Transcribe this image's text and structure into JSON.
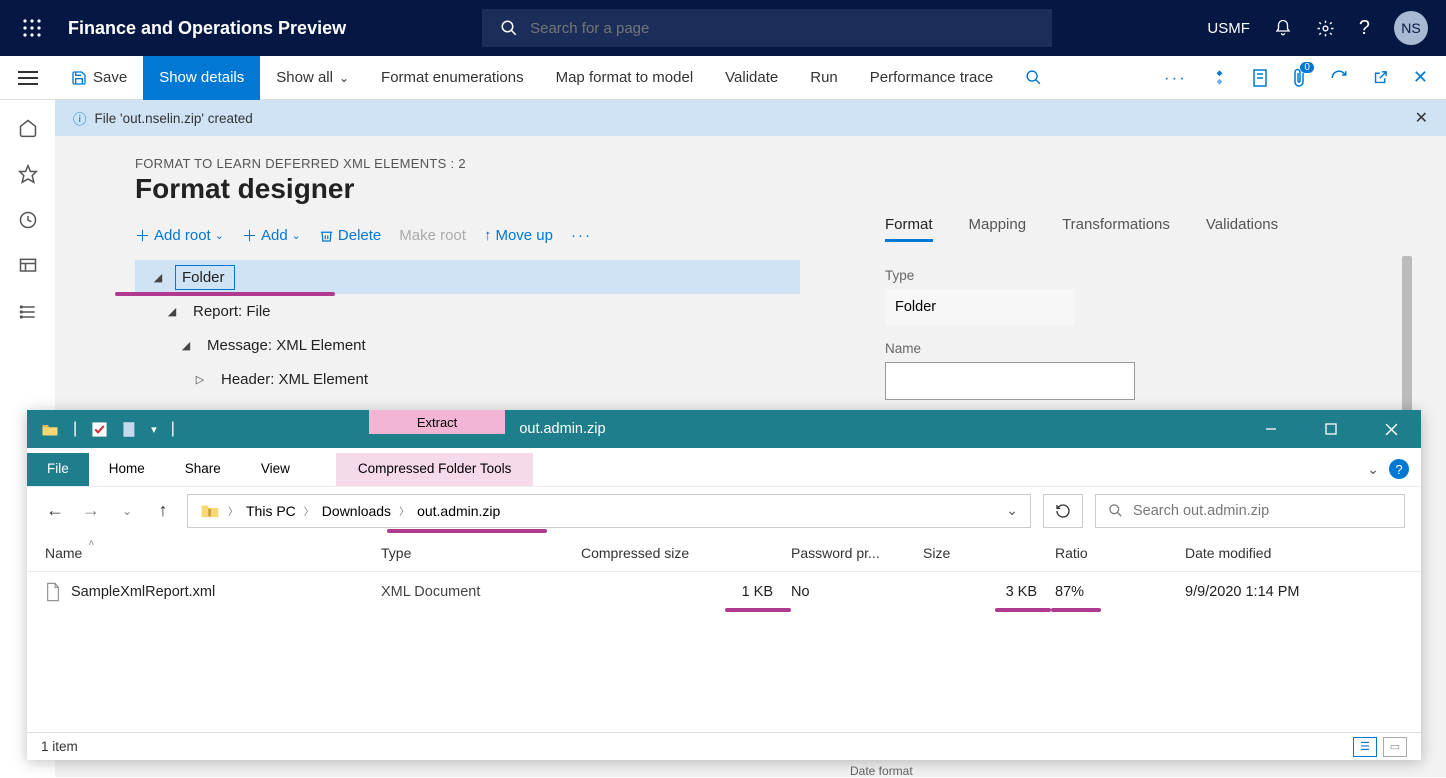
{
  "colors": {
    "accent": "#0078d4",
    "navbg": "#051743",
    "pink": "#b03a8f",
    "teal": "#1e7e8c"
  },
  "topnav": {
    "app_title": "Finance and Operations Preview",
    "search_placeholder": "Search for a page",
    "entity": "USMF",
    "avatar": "NS"
  },
  "cmdbar": {
    "save": "Save",
    "show_details": "Show details",
    "show_all": "Show all",
    "format_enum": "Format enumerations",
    "map_format": "Map format to model",
    "validate": "Validate",
    "run": "Run",
    "perf_trace": "Performance trace",
    "notif_badge": "0"
  },
  "infobar": {
    "msg": "File 'out.nselin.zip' created"
  },
  "page": {
    "breadcrumb": "FORMAT TO LEARN DEFERRED XML ELEMENTS : 2",
    "title": "Format designer"
  },
  "tree_tb": {
    "add_root": "Add root",
    "add": "Add",
    "delete": "Delete",
    "make_root": "Make root",
    "move_up": "Move up"
  },
  "tree": {
    "n0": "Folder",
    "n1": "Report: File",
    "n2": "Message: XML Element",
    "n3": "Header: XML Element"
  },
  "rpanel": {
    "tabs": {
      "format": "Format",
      "mapping": "Mapping",
      "transformations": "Transformations",
      "validations": "Validations"
    },
    "type_label": "Type",
    "type_value": "Folder",
    "name_label": "Name",
    "name_value": ""
  },
  "explorer": {
    "extract_tab": "Extract",
    "title": "out.admin.zip",
    "ribbon": {
      "file": "File",
      "home": "Home",
      "share": "Share",
      "view": "View",
      "comp_tools": "Compressed Folder Tools"
    },
    "breadcrumbs": {
      "pc": "This PC",
      "dl": "Downloads",
      "zip": "out.admin.zip"
    },
    "search_placeholder": "Search out.admin.zip",
    "columns": {
      "name": "Name",
      "type": "Type",
      "comp": "Compressed size",
      "pwd": "Password pr...",
      "size": "Size",
      "ratio": "Ratio",
      "date": "Date modified"
    },
    "row": {
      "name": "SampleXmlReport.xml",
      "type": "XML Document",
      "comp": "1 KB",
      "pwd": "No",
      "size": "3 KB",
      "ratio": "87%",
      "date": "9/9/2020 1:14 PM"
    },
    "status": "1 item"
  },
  "footer": {
    "date_format": "Date format"
  }
}
